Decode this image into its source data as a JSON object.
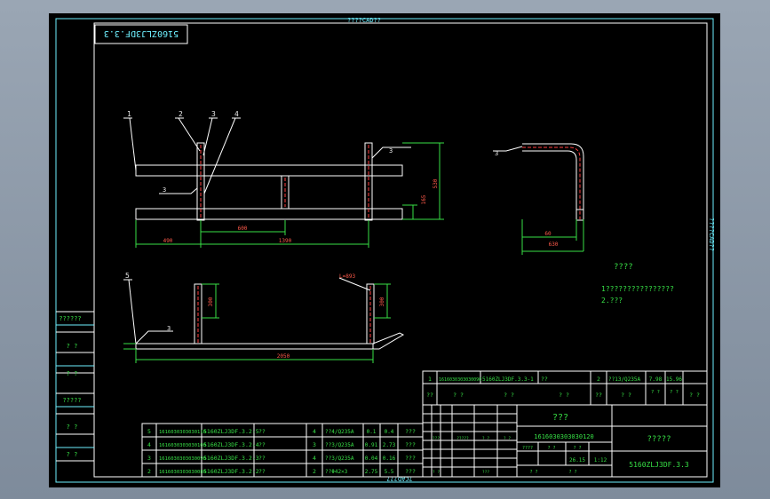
{
  "frame": {
    "top_label": "????CAD??",
    "bottom_label": "?CAD???",
    "right_label": "????CAD??",
    "drawing_code": "5160ZLJ3DF.3.3"
  },
  "notes": {
    "title": "????",
    "line1": "1????????????????",
    "line2": "2.???"
  },
  "callouts": [
    "1",
    "2",
    "3",
    "4",
    "5"
  ],
  "dimensions": {
    "front_490": "490",
    "front_600": "600",
    "front_1390": "1390",
    "front_height_530": "530",
    "front_height_165": "165",
    "side_60": "60",
    "side_630": "630",
    "bottom_300_left": "300",
    "bottom_300_right": "300",
    "bottom_2050": "2050",
    "bottom_tag": "L=893"
  },
  "weld_symbols": [
    "3",
    "3",
    "3",
    "3"
  ],
  "left_zone_labels": [
    "??????",
    "? ?",
    "? ?",
    "?????",
    "? ?",
    "? ?"
  ],
  "bom": [
    {
      "no": "5",
      "code": "1616030303030110",
      "name": "5160ZLJ3DF.3.2-5",
      "desc": "??",
      "qty": "4",
      "mat": "??4/Q235A",
      "unit": "0.1",
      "total": "0.4",
      "note": "???"
    },
    {
      "no": "4",
      "code": "1616030303030100",
      "name": "5160ZLJ3DF.3.2-4",
      "desc": "??",
      "qty": "3",
      "mat": "??3/Q235A",
      "unit": "0.91",
      "total": "2.73",
      "note": "???"
    },
    {
      "no": "3",
      "code": "1616030303030090",
      "name": "5160ZLJ3DF.3.2-3",
      "desc": "??",
      "qty": "4",
      "mat": "??3/Q235A",
      "unit": "0.04",
      "total": "0.16",
      "note": "???"
    },
    {
      "no": "2",
      "code": "1616030303030080",
      "name": "5160ZLJ3DF.3.2-2",
      "desc": "??",
      "qty": "2",
      "mat": "??Φ42×3",
      "unit": "2.75",
      "total": "5.5",
      "note": "???"
    },
    {
      "no": "1",
      "code": "1616030303030090",
      "name": "5160ZLJ3DF.3.3-1",
      "desc": "??",
      "qty": "2",
      "mat": "??13/Q235A",
      "unit": "7.98",
      "total": "15.96",
      "note": ""
    }
  ],
  "bom_header": [
    "??",
    "? ?",
    "? ?",
    "? ?",
    "??",
    "? ?",
    "? ?",
    "? ?",
    "? ?"
  ],
  "title_block": {
    "company": "???",
    "part_code": "1616030303030120",
    "drawing_name": "?????",
    "drawing_no": "5160ZLJ3DF.3.3",
    "sheet_labels": [
      "????",
      "? ?",
      "? ?"
    ],
    "scale": "1:12",
    "weight": "26.15",
    "small_cells": [
      "? ?",
      "? ?",
      "???",
      "?????",
      "? ?",
      "? ?",
      "? ?",
      "???"
    ]
  }
}
